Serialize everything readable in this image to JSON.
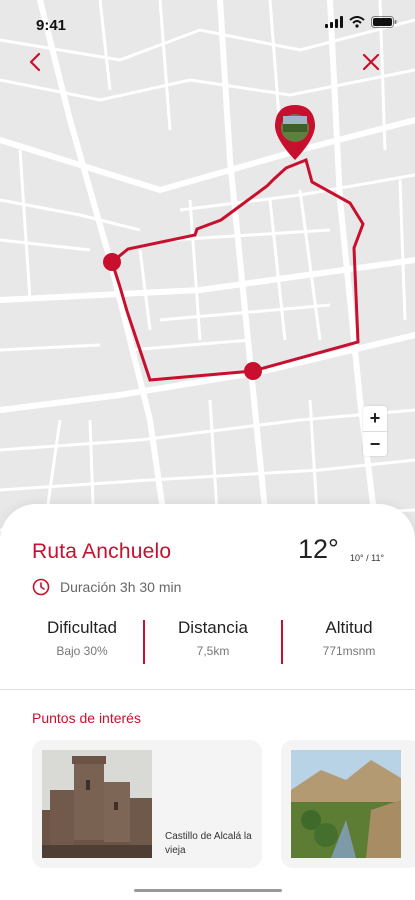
{
  "status_bar": {
    "time": "9:41"
  },
  "route": {
    "title": "Ruta Anchuelo",
    "duration": "Duración 3h 30 min"
  },
  "weather": {
    "temperature": "12°",
    "range": "10° / 11°"
  },
  "stats": [
    {
      "label": "Dificultad",
      "value": "Bajo 30%"
    },
    {
      "label": "Distancia",
      "value": "7,5km"
    },
    {
      "label": "Altitud",
      "value": "771msnm"
    }
  ],
  "poi": {
    "title": "Puntos de interés",
    "items": [
      {
        "caption": "Castillo de Alcalá la vieja"
      },
      {
        "caption": ""
      }
    ]
  },
  "map": {
    "zoom_in": "+",
    "zoom_out": "−"
  },
  "colors": {
    "accent": "#c8102e",
    "map_bg": "#e8e8e9",
    "road": "#ffffff"
  },
  "icons": [
    "back-chevron-icon",
    "close-icon",
    "clock-icon",
    "signal-icon",
    "wifi-icon",
    "battery-icon",
    "location-pin-icon"
  ]
}
